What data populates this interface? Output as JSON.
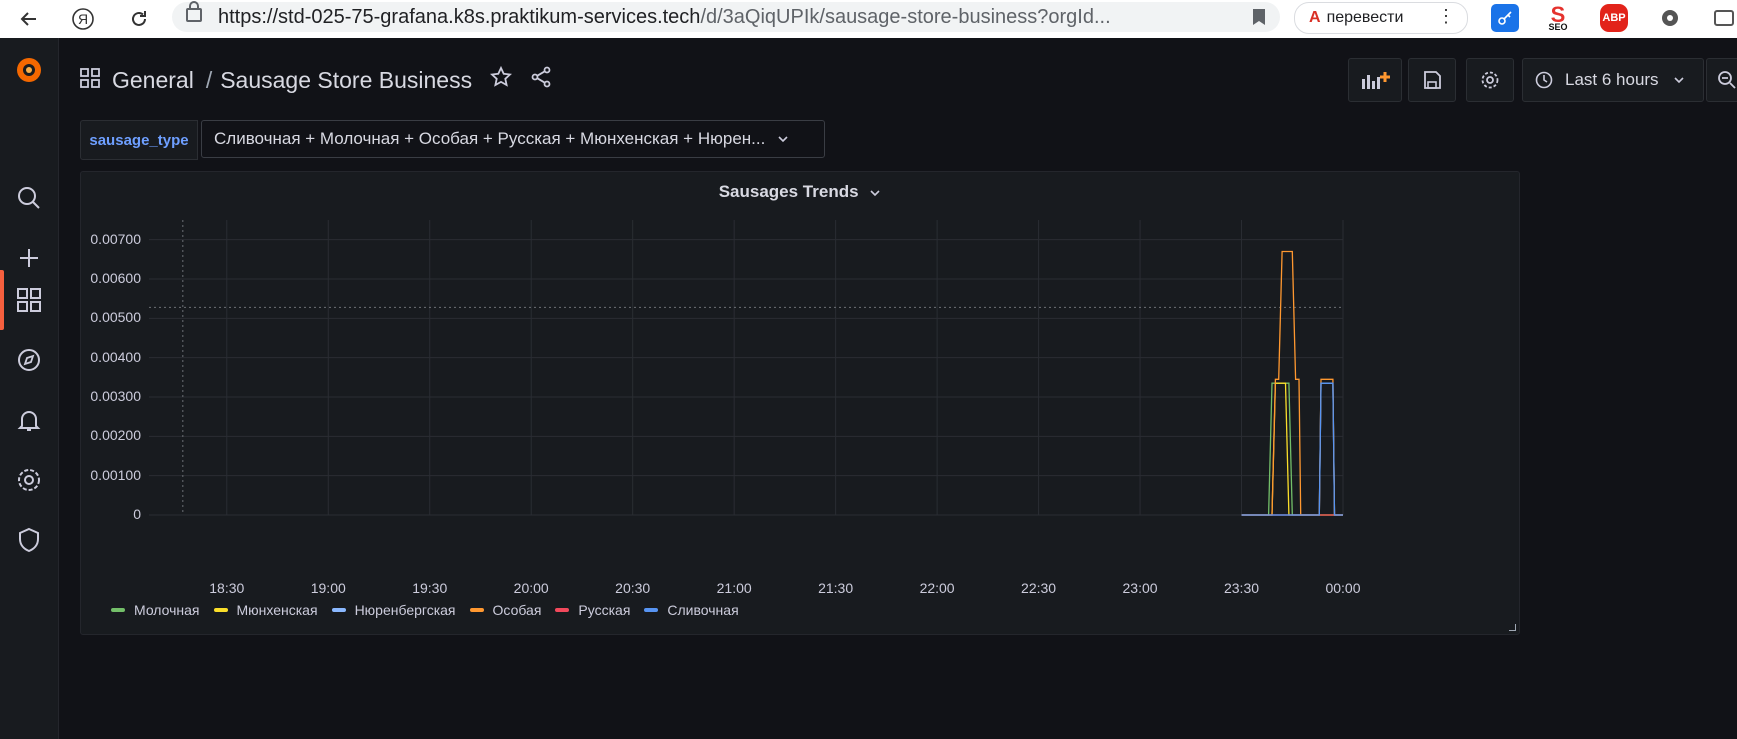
{
  "browser": {
    "url_main": "https://std-025-75-grafana.k8s.praktikum-services.tech",
    "url_rest": "/d/3aQiqUPIk/sausage-store-business?orgId...",
    "translate_label": "перевести",
    "ext_seo": "SEO",
    "ext_abp": "ABP"
  },
  "breadcrumb": {
    "folder": "General",
    "separator": "/",
    "dashboard": "Sausage Store Business"
  },
  "toolbar": {
    "time_range": "Last 6 hours"
  },
  "variable": {
    "name": "sausage_type",
    "value": "Сливочная + Молочная + Особая + Русская + Мюнхенская + Нюрен..."
  },
  "panel": {
    "title": "Sausages Trends"
  },
  "chart_data": {
    "type": "line",
    "title": "Sausages Trends",
    "x_ticks": [
      "18:30",
      "19:00",
      "19:30",
      "20:00",
      "20:30",
      "21:00",
      "21:30",
      "22:00",
      "22:30",
      "23:00",
      "23:30",
      "00:00"
    ],
    "y_ticks": [
      "0.00700",
      "0.00600",
      "0.00500",
      "0.00400",
      "0.00300",
      "0.00200",
      "0.00100",
      "0"
    ],
    "ylim": [
      0,
      0.0075
    ],
    "x_unit": "minutes",
    "xlim": [
      1087,
      1440
    ],
    "threshold_y": 0.00528,
    "series": [
      {
        "name": "Молочная",
        "color": "#73bf69",
        "points": [
          [
            1410,
            0
          ],
          [
            1418,
            0
          ],
          [
            1419,
            0.00335
          ],
          [
            1422,
            0.00335
          ],
          [
            1423,
            0.00335
          ],
          [
            1424,
            0.00335
          ],
          [
            1425,
            0
          ],
          [
            1440,
            0
          ]
        ]
      },
      {
        "name": "Мюнхенская",
        "color": "#fade2a",
        "points": [
          [
            1410,
            0
          ],
          [
            1419,
            0
          ],
          [
            1420,
            0.00335
          ],
          [
            1423,
            0.00335
          ],
          [
            1424,
            0
          ],
          [
            1440,
            0
          ]
        ]
      },
      {
        "name": "Нюренбергская",
        "color": "#8ab8ff",
        "points": [
          [
            1410,
            0
          ],
          [
            1433,
            0
          ],
          [
            1433.5,
            0.00335
          ],
          [
            1437,
            0.00335
          ],
          [
            1437.5,
            0
          ],
          [
            1440,
            0
          ]
        ]
      },
      {
        "name": "Особая",
        "color": "#ff9830",
        "points": [
          [
            1410,
            0
          ],
          [
            1419,
            0
          ],
          [
            1420,
            0.00345
          ],
          [
            1421,
            0.00345
          ],
          [
            1422,
            0.0067
          ],
          [
            1425,
            0.0067
          ],
          [
            1426,
            0.00345
          ],
          [
            1427,
            0.00345
          ],
          [
            1427.5,
            0
          ],
          [
            1433,
            0
          ],
          [
            1433.5,
            0.00345
          ],
          [
            1437,
            0.00345
          ],
          [
            1437.5,
            0
          ],
          [
            1440,
            0
          ]
        ]
      },
      {
        "name": "Русская",
        "color": "#f2495c",
        "points": [
          [
            1410,
            0
          ],
          [
            1433,
            0
          ],
          [
            1437,
            0
          ],
          [
            1440,
            0
          ]
        ]
      },
      {
        "name": "Сливочная",
        "color": "#5794f2",
        "points": [
          [
            1410,
            0
          ],
          [
            1433,
            0
          ],
          [
            1433.5,
            0.00335
          ],
          [
            1437,
            0.00335
          ],
          [
            1437.5,
            0
          ],
          [
            1440,
            0
          ]
        ]
      }
    ]
  }
}
